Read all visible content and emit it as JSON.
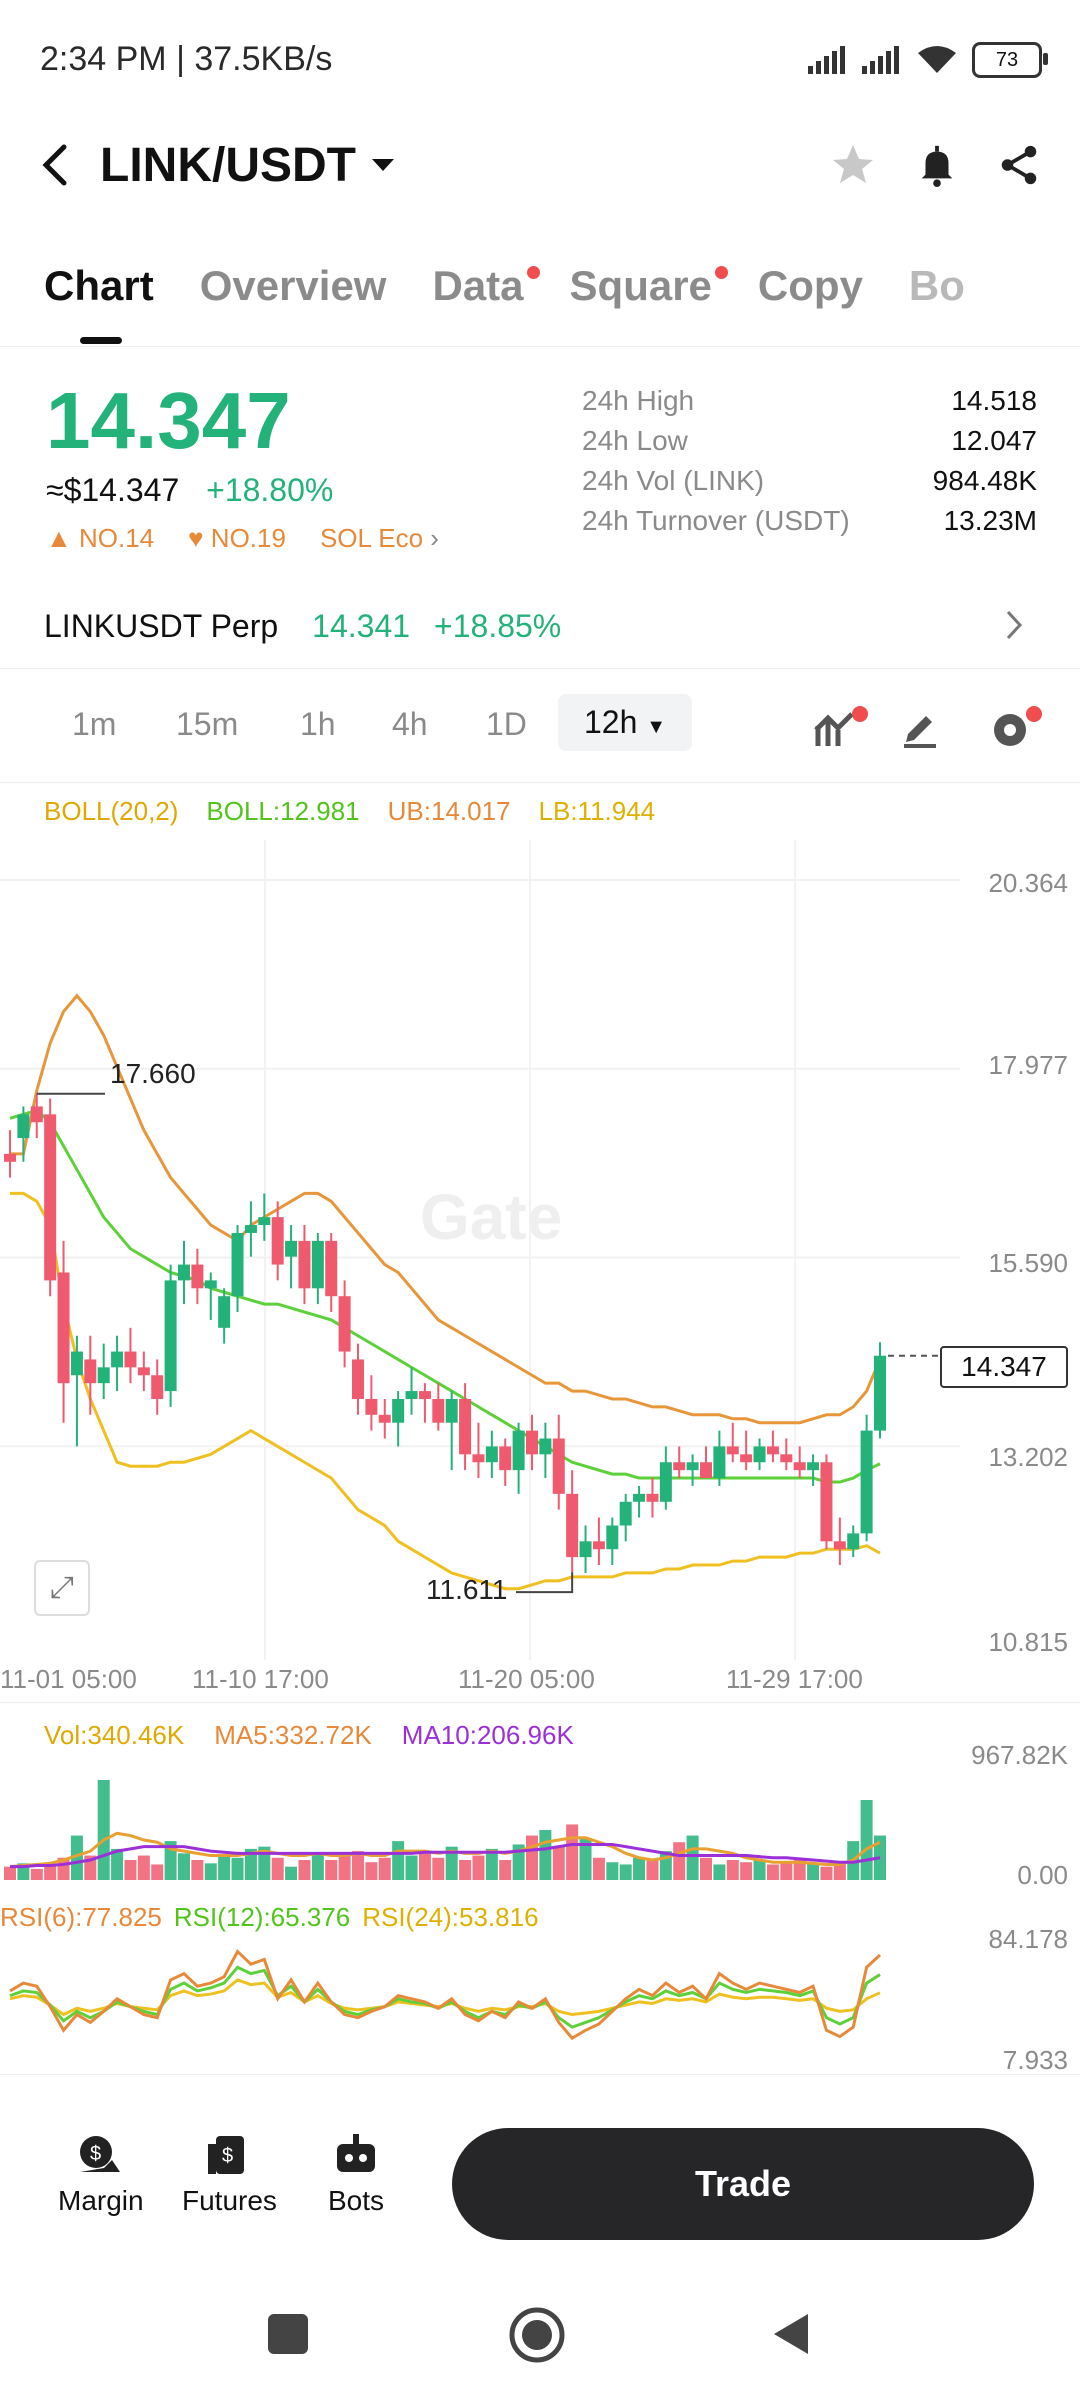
{
  "status": {
    "time": "2:34 PM | 37.5KB/s",
    "battery": "73"
  },
  "header": {
    "pair": "LINK/USDT"
  },
  "tabs": [
    {
      "label": "Chart",
      "active": true,
      "dot": false
    },
    {
      "label": "Overview",
      "active": false,
      "dot": false
    },
    {
      "label": "Data",
      "active": false,
      "dot": true
    },
    {
      "label": "Square",
      "active": false,
      "dot": true
    },
    {
      "label": "Copy",
      "active": false,
      "dot": false
    },
    {
      "label": "Bo",
      "active": false,
      "dot": false
    }
  ],
  "ticker": {
    "price": "14.347",
    "approx": "≈$14.347",
    "change": "+18.80%",
    "ranks": [
      "NO.14",
      "NO.19",
      "SOL Eco"
    ],
    "stats": [
      {
        "k": "24h High",
        "v": "14.518"
      },
      {
        "k": "24h Low",
        "v": "12.047"
      },
      {
        "k": "24h Vol (LINK)",
        "v": "984.48K"
      },
      {
        "k": "24h Turnover (USDT)",
        "v": "13.23M"
      }
    ]
  },
  "perp": {
    "name": "LINKUSDT Perp",
    "price": "14.341",
    "change": "+18.85%"
  },
  "timeframes": [
    "1m",
    "15m",
    "1h",
    "4h",
    "1D",
    "12h"
  ],
  "active_timeframe": "12h",
  "boll": {
    "label": "BOLL(20,2)",
    "mid": "BOLL:12.981",
    "ub": "UB:14.017",
    "lb": "LB:11.944"
  },
  "price_axis": [
    "20.364",
    "17.977",
    "15.590",
    "13.202",
    "10.815"
  ],
  "time_axis": [
    "11-01 05:00",
    "11-10 17:00",
    "11-20 05:00",
    "11-29 17:00"
  ],
  "annotations": {
    "high": "17.660",
    "low": "11.611",
    "last": "14.347"
  },
  "watermark": "Gate",
  "vol": {
    "vol": "Vol:340.46K",
    "ma5": "MA5:332.72K",
    "ma10": "MA10:206.96K",
    "max": "967.82K",
    "min": "0.00"
  },
  "rsi": {
    "r6": "RSI(6):77.825",
    "r12": "RSI(12):65.376",
    "r24": "RSI(24):53.816",
    "max": "84.178",
    "min": "7.933"
  },
  "nav": [
    {
      "label": "Margin",
      "icon": "margin-icon"
    },
    {
      "label": "Futures",
      "icon": "futures-icon"
    },
    {
      "label": "Bots",
      "icon": "bots-icon"
    }
  ],
  "trade_label": "Trade",
  "colors": {
    "up": "#23b27a",
    "down": "#ef5a6f",
    "accent": "#e8893a"
  },
  "chart_data": {
    "type": "candlestick",
    "candles": [
      {
        "o": 16.9,
        "h": 17.2,
        "l": 16.6,
        "c": 16.8
      },
      {
        "o": 17.1,
        "h": 17.5,
        "l": 16.8,
        "c": 17.4
      },
      {
        "o": 17.5,
        "h": 17.66,
        "l": 17.1,
        "c": 17.3
      },
      {
        "o": 17.4,
        "h": 17.6,
        "l": 15.1,
        "c": 15.3
      },
      {
        "o": 15.4,
        "h": 15.8,
        "l": 13.5,
        "c": 14.0
      },
      {
        "o": 14.1,
        "h": 14.6,
        "l": 13.2,
        "c": 14.4
      },
      {
        "o": 14.3,
        "h": 14.6,
        "l": 13.6,
        "c": 14.0
      },
      {
        "o": 14.0,
        "h": 14.5,
        "l": 13.8,
        "c": 14.2
      },
      {
        "o": 14.2,
        "h": 14.6,
        "l": 13.9,
        "c": 14.4
      },
      {
        "o": 14.4,
        "h": 14.7,
        "l": 14.0,
        "c": 14.2
      },
      {
        "o": 14.2,
        "h": 14.4,
        "l": 13.9,
        "c": 14.1
      },
      {
        "o": 14.1,
        "h": 14.3,
        "l": 13.6,
        "c": 13.8
      },
      {
        "o": 13.9,
        "h": 15.5,
        "l": 13.7,
        "c": 15.3
      },
      {
        "o": 15.3,
        "h": 15.8,
        "l": 15.0,
        "c": 15.5
      },
      {
        "o": 15.5,
        "h": 15.7,
        "l": 15.0,
        "c": 15.2
      },
      {
        "o": 15.2,
        "h": 15.4,
        "l": 14.8,
        "c": 15.3
      },
      {
        "o": 14.7,
        "h": 15.2,
        "l": 14.5,
        "c": 15.1
      },
      {
        "o": 15.1,
        "h": 16.0,
        "l": 14.9,
        "c": 15.9
      },
      {
        "o": 15.9,
        "h": 16.3,
        "l": 15.6,
        "c": 16.0
      },
      {
        "o": 16.0,
        "h": 16.4,
        "l": 15.8,
        "c": 16.1
      },
      {
        "o": 16.1,
        "h": 16.3,
        "l": 15.3,
        "c": 15.5
      },
      {
        "o": 15.6,
        "h": 16.0,
        "l": 15.2,
        "c": 15.8
      },
      {
        "o": 15.8,
        "h": 16.0,
        "l": 15.0,
        "c": 15.2
      },
      {
        "o": 15.2,
        "h": 15.9,
        "l": 15.0,
        "c": 15.8
      },
      {
        "o": 15.8,
        "h": 15.9,
        "l": 14.9,
        "c": 15.1
      },
      {
        "o": 15.1,
        "h": 15.3,
        "l": 14.2,
        "c": 14.4
      },
      {
        "o": 14.3,
        "h": 14.5,
        "l": 13.6,
        "c": 13.8
      },
      {
        "o": 13.8,
        "h": 14.1,
        "l": 13.4,
        "c": 13.6
      },
      {
        "o": 13.6,
        "h": 13.8,
        "l": 13.3,
        "c": 13.5
      },
      {
        "o": 13.5,
        "h": 13.9,
        "l": 13.2,
        "c": 13.8
      },
      {
        "o": 13.8,
        "h": 14.2,
        "l": 13.6,
        "c": 13.9
      },
      {
        "o": 13.9,
        "h": 14.0,
        "l": 13.5,
        "c": 13.8
      },
      {
        "o": 13.8,
        "h": 14.0,
        "l": 13.4,
        "c": 13.5
      },
      {
        "o": 13.5,
        "h": 13.9,
        "l": 12.9,
        "c": 13.8
      },
      {
        "o": 13.8,
        "h": 14.0,
        "l": 12.9,
        "c": 13.1
      },
      {
        "o": 13.1,
        "h": 13.5,
        "l": 12.8,
        "c": 13.0
      },
      {
        "o": 13.0,
        "h": 13.4,
        "l": 12.8,
        "c": 13.2
      },
      {
        "o": 13.2,
        "h": 13.3,
        "l": 12.7,
        "c": 12.9
      },
      {
        "o": 12.9,
        "h": 13.5,
        "l": 12.6,
        "c": 13.4
      },
      {
        "o": 13.4,
        "h": 13.6,
        "l": 12.9,
        "c": 13.1
      },
      {
        "o": 13.1,
        "h": 13.5,
        "l": 12.8,
        "c": 13.3
      },
      {
        "o": 13.3,
        "h": 13.6,
        "l": 12.4,
        "c": 12.6
      },
      {
        "o": 12.6,
        "h": 12.9,
        "l": 11.611,
        "c": 11.8
      },
      {
        "o": 11.8,
        "h": 12.2,
        "l": 11.6,
        "c": 12.0
      },
      {
        "o": 12.0,
        "h": 12.3,
        "l": 11.7,
        "c": 11.9
      },
      {
        "o": 11.9,
        "h": 12.3,
        "l": 11.7,
        "c": 12.2
      },
      {
        "o": 12.2,
        "h": 12.6,
        "l": 12.0,
        "c": 12.5
      },
      {
        "o": 12.5,
        "h": 12.7,
        "l": 12.3,
        "c": 12.6
      },
      {
        "o": 12.6,
        "h": 12.8,
        "l": 12.3,
        "c": 12.5
      },
      {
        "o": 12.5,
        "h": 13.2,
        "l": 12.4,
        "c": 13.0
      },
      {
        "o": 13.0,
        "h": 13.2,
        "l": 12.8,
        "c": 12.9
      },
      {
        "o": 12.9,
        "h": 13.1,
        "l": 12.7,
        "c": 13.0
      },
      {
        "o": 13.0,
        "h": 13.2,
        "l": 12.8,
        "c": 12.8
      },
      {
        "o": 12.8,
        "h": 13.4,
        "l": 12.7,
        "c": 13.2
      },
      {
        "o": 13.2,
        "h": 13.5,
        "l": 13.0,
        "c": 13.1
      },
      {
        "o": 13.1,
        "h": 13.4,
        "l": 12.9,
        "c": 13.0
      },
      {
        "o": 13.0,
        "h": 13.3,
        "l": 12.9,
        "c": 13.2
      },
      {
        "o": 13.2,
        "h": 13.4,
        "l": 13.0,
        "c": 13.1
      },
      {
        "o": 13.1,
        "h": 13.3,
        "l": 12.9,
        "c": 13.0
      },
      {
        "o": 13.0,
        "h": 13.2,
        "l": 12.8,
        "c": 12.9
      },
      {
        "o": 12.9,
        "h": 13.1,
        "l": 12.7,
        "c": 13.0
      },
      {
        "o": 13.0,
        "h": 13.1,
        "l": 11.9,
        "c": 12.0
      },
      {
        "o": 12.0,
        "h": 12.3,
        "l": 11.7,
        "c": 11.9
      },
      {
        "o": 11.9,
        "h": 12.2,
        "l": 11.8,
        "c": 12.1
      },
      {
        "o": 12.1,
        "h": 13.6,
        "l": 12.0,
        "c": 13.4
      },
      {
        "o": 13.4,
        "h": 14.518,
        "l": 13.3,
        "c": 14.347
      }
    ],
    "boll_upper": [
      16.9,
      16.9,
      17.7,
      18.3,
      18.7,
      18.9,
      18.7,
      18.4,
      18.0,
      17.6,
      17.2,
      16.9,
      16.6,
      16.4,
      16.2,
      16.0,
      15.9,
      15.8,
      16.0,
      16.1,
      16.2,
      16.3,
      16.4,
      16.4,
      16.3,
      16.1,
      15.9,
      15.7,
      15.5,
      15.4,
      15.2,
      15.0,
      14.8,
      14.7,
      14.6,
      14.5,
      14.4,
      14.3,
      14.2,
      14.1,
      14.0,
      14.0,
      13.9,
      13.9,
      13.85,
      13.8,
      13.8,
      13.75,
      13.7,
      13.7,
      13.65,
      13.6,
      13.6,
      13.6,
      13.55,
      13.55,
      13.5,
      13.5,
      13.5,
      13.5,
      13.55,
      13.6,
      13.6,
      13.7,
      13.9,
      14.3
    ],
    "boll_mid": [
      17.35,
      17.4,
      17.45,
      17.3,
      17.0,
      16.7,
      16.4,
      16.1,
      15.9,
      15.7,
      15.6,
      15.5,
      15.4,
      15.35,
      15.3,
      15.2,
      15.15,
      15.1,
      15.05,
      15.0,
      15.0,
      14.95,
      14.9,
      14.85,
      14.8,
      14.7,
      14.6,
      14.5,
      14.4,
      14.3,
      14.2,
      14.1,
      14.0,
      13.9,
      13.8,
      13.7,
      13.6,
      13.5,
      13.4,
      13.3,
      13.2,
      13.1,
      13.0,
      12.95,
      12.9,
      12.85,
      12.85,
      12.8,
      12.8,
      12.8,
      12.8,
      12.8,
      12.8,
      12.8,
      12.8,
      12.8,
      12.8,
      12.8,
      12.8,
      12.8,
      12.8,
      12.75,
      12.75,
      12.8,
      12.9,
      12.981
    ],
    "boll_lower": [
      16.4,
      16.4,
      16.3,
      16.0,
      15.0,
      14.3,
      13.8,
      13.4,
      13.0,
      12.95,
      12.95,
      12.95,
      13.0,
      13.0,
      13.05,
      13.1,
      13.2,
      13.3,
      13.4,
      13.3,
      13.2,
      13.1,
      13.0,
      12.9,
      12.8,
      12.6,
      12.4,
      12.3,
      12.2,
      12.0,
      11.9,
      11.8,
      11.7,
      11.6,
      11.55,
      11.5,
      11.45,
      11.4,
      11.4,
      11.45,
      11.5,
      11.5,
      11.55,
      11.55,
      11.55,
      11.55,
      11.6,
      11.6,
      11.6,
      11.65,
      11.65,
      11.7,
      11.7,
      11.7,
      11.75,
      11.75,
      11.8,
      11.8,
      11.8,
      11.85,
      11.85,
      11.9,
      11.9,
      11.9,
      11.944,
      11.85
    ],
    "volume": [
      12,
      15,
      10,
      14,
      20,
      40,
      22,
      90,
      28,
      18,
      22,
      14,
      35,
      24,
      18,
      15,
      22,
      20,
      28,
      30,
      20,
      12,
      18,
      24,
      18,
      22,
      26,
      16,
      20,
      35,
      22,
      26,
      20,
      30,
      18,
      22,
      28,
      18,
      32,
      40,
      45,
      30,
      50,
      38,
      20,
      16,
      14,
      20,
      18,
      26,
      34,
      40,
      20,
      14,
      18,
      16,
      18,
      14,
      16,
      18,
      14,
      12,
      15,
      35,
      72,
      40
    ],
    "vol_ma5": [
      12,
      13,
      14,
      15,
      18,
      22,
      26,
      36,
      42,
      40,
      36,
      34,
      28,
      26,
      24,
      22,
      22,
      22,
      24,
      26,
      24,
      22,
      22,
      24,
      22,
      22,
      24,
      22,
      22,
      26,
      26,
      26,
      24,
      26,
      24,
      24,
      26,
      24,
      26,
      30,
      34,
      36,
      38,
      38,
      34,
      30,
      24,
      20,
      18,
      20,
      24,
      28,
      28,
      26,
      24,
      20,
      18,
      16,
      16,
      16,
      15,
      14,
      14,
      18,
      28,
      34
    ],
    "vol_ma10": [
      12,
      12,
      13,
      13,
      14,
      16,
      18,
      22,
      26,
      28,
      30,
      30,
      30,
      30,
      28,
      26,
      25,
      24,
      24,
      24,
      24,
      24,
      24,
      24,
      24,
      24,
      24,
      24,
      24,
      24,
      24,
      25,
      25,
      25,
      25,
      25,
      25,
      25,
      26,
      27,
      28,
      30,
      32,
      32,
      32,
      32,
      30,
      28,
      26,
      24,
      22,
      22,
      22,
      22,
      22,
      22,
      21,
      20,
      20,
      19,
      18,
      17,
      16,
      16,
      18,
      20
    ],
    "rsi6": [
      55,
      60,
      58,
      45,
      30,
      40,
      35,
      42,
      50,
      45,
      40,
      38,
      62,
      66,
      58,
      60,
      64,
      80,
      72,
      75,
      50,
      62,
      48,
      60,
      48,
      40,
      38,
      42,
      45,
      52,
      50,
      48,
      44,
      50,
      40,
      36,
      42,
      38,
      48,
      44,
      50,
      35,
      25,
      30,
      34,
      42,
      50,
      56,
      52,
      60,
      54,
      58,
      50,
      66,
      60,
      56,
      60,
      58,
      56,
      54,
      58,
      30,
      26,
      32,
      70,
      77.8
    ],
    "rsi12": [
      52,
      55,
      54,
      46,
      36,
      42,
      38,
      42,
      48,
      45,
      42,
      40,
      56,
      60,
      55,
      57,
      60,
      70,
      66,
      68,
      52,
      58,
      48,
      56,
      48,
      42,
      40,
      43,
      45,
      50,
      48,
      47,
      44,
      48,
      42,
      38,
      42,
      40,
      46,
      44,
      48,
      38,
      32,
      35,
      38,
      43,
      48,
      52,
      50,
      55,
      52,
      54,
      50,
      60,
      56,
      54,
      56,
      55,
      54,
      52,
      55,
      38,
      34,
      38,
      60,
      65.4
    ],
    "rsi24": [
      50,
      52,
      51,
      46,
      40,
      44,
      42,
      44,
      47,
      45,
      44,
      43,
      52,
      55,
      52,
      53,
      55,
      62,
      59,
      60,
      51,
      54,
      48,
      52,
      47,
      44,
      43,
      44,
      45,
      48,
      47,
      46,
      45,
      47,
      44,
      42,
      44,
      43,
      45,
      45,
      47,
      42,
      40,
      41,
      42,
      44,
      46,
      48,
      47,
      50,
      49,
      50,
      48,
      53,
      51,
      50,
      51,
      51,
      50,
      49,
      50,
      44,
      42,
      43,
      50,
      53.8
    ]
  }
}
